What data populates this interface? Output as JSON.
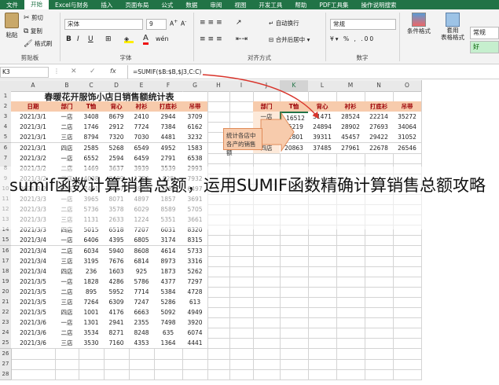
{
  "menu": [
    "文件",
    "开始",
    "Excel与财务",
    "插入",
    "页面布局",
    "公式",
    "数据",
    "审阅",
    "视图",
    "开发工具",
    "帮助",
    "PDF工具集",
    "操作说明搜索"
  ],
  "ribbon": {
    "paste": "粘贴",
    "cut": "剪切",
    "copy": "复制",
    "format_painter": "格式刷",
    "clipboard_group": "剪贴板",
    "font_name": "宋体",
    "font_size": "9",
    "font_group": "字体",
    "wrap_text": "自动换行",
    "merge_center": "合并后居中",
    "align_group": "对齐方式",
    "number_format": "常规",
    "number_group": "数字",
    "cond_format": "条件格式",
    "table_format": "套用\n表格格式",
    "style_normal": "常规",
    "style_good": "好"
  },
  "formula_bar": {
    "name_box": "K3",
    "fx": "fx",
    "formula": "=SUMIF($B:$B,$J3,C:C)"
  },
  "columns": [
    "A",
    "B",
    "C",
    "D",
    "E",
    "F",
    "G",
    "H",
    "I",
    "J",
    "K",
    "L",
    "M",
    "N",
    "O"
  ],
  "sheet": {
    "title": "春暖花开服饰小店日销售额统计表",
    "headers": [
      "日期",
      "部门",
      "T恤",
      "背心",
      "衬衫",
      "打底衫",
      "吊带"
    ],
    "rows": [
      [
        "2021/3/1",
        "一店",
        "3408",
        "8679",
        "2410",
        "2944",
        "3709"
      ],
      [
        "2021/3/1",
        "二店",
        "1746",
        "2912",
        "7724",
        "7384",
        "6162"
      ],
      [
        "2021/3/1",
        "三店",
        "8794",
        "7320",
        "7030",
        "4481",
        "3232"
      ],
      [
        "2021/3/1",
        "四店",
        "2585",
        "5268",
        "6549",
        "4952",
        "1583"
      ],
      [
        "2021/3/2",
        "一店",
        "6552",
        "2594",
        "6459",
        "2791",
        "6538"
      ],
      [
        "2021/3/2",
        "二店",
        "1469",
        "3637",
        "3939",
        "3539",
        "2993"
      ],
      [
        "2021/3/2",
        "三店",
        "4038",
        "8409",
        "1774",
        "828",
        "7932"
      ],
      [
        "2021/3/2",
        "四店",
        "7491",
        "3957",
        "3984",
        "3483",
        "6497"
      ],
      [
        "2021/3/3",
        "一店",
        "3965",
        "8071",
        "4897",
        "1857",
        "3691"
      ],
      [
        "2021/3/3",
        "二店",
        "5736",
        "3578",
        "6029",
        "8589",
        "5705"
      ],
      [
        "2021/3/3",
        "三店",
        "1131",
        "2633",
        "1224",
        "5351",
        "3661"
      ],
      [
        "2021/3/3",
        "四店",
        "5015",
        "6518",
        "7207",
        "6031",
        "8320"
      ],
      [
        "2021/3/4",
        "一店",
        "6406",
        "4395",
        "6805",
        "3174",
        "8315"
      ],
      [
        "2021/3/4",
        "二店",
        "6034",
        "5940",
        "8608",
        "4614",
        "5733"
      ],
      [
        "2021/3/4",
        "三店",
        "3195",
        "7676",
        "6814",
        "8973",
        "3316"
      ],
      [
        "2021/3/4",
        "四店",
        "236",
        "1603",
        "925",
        "1873",
        "5262"
      ],
      [
        "2021/3/5",
        "一店",
        "1828",
        "4286",
        "5786",
        "4377",
        "7297"
      ],
      [
        "2021/3/5",
        "二店",
        "895",
        "5952",
        "7714",
        "5384",
        "4728"
      ],
      [
        "2021/3/5",
        "三店",
        "7264",
        "6309",
        "7247",
        "5286",
        "613"
      ],
      [
        "2021/3/5",
        "四店",
        "1001",
        "4176",
        "6663",
        "5092",
        "4949"
      ],
      [
        "2021/3/6",
        "一店",
        "1301",
        "2941",
        "2355",
        "7498",
        "3920"
      ],
      [
        "2021/3/6",
        "二店",
        "3534",
        "8271",
        "8248",
        "635",
        "6074"
      ],
      [
        "2021/3/6",
        "三店",
        "3530",
        "7160",
        "4353",
        "1364",
        "4441"
      ]
    ],
    "note": "统计各店中各产的销售额",
    "summary_headers": [
      "部门",
      "T恤",
      "背心",
      "衬衫",
      "打底衫",
      "吊带"
    ],
    "summary_rows": [
      [
        "一店",
        "16512",
        "31471",
        "28524",
        "22214",
        "35272"
      ],
      [
        "二店",
        "15219",
        "24894",
        "28902",
        "27693",
        "34064"
      ],
      [
        "三店",
        "32801",
        "39311",
        "45457",
        "29422",
        "31052"
      ],
      [
        "四店",
        "20863",
        "37485",
        "27961",
        "22678",
        "26546"
      ]
    ]
  },
  "caption": "sumif函数计算销售总额，运用SUMIF函数精确计算销售总额攻略",
  "colors": {
    "accent": "#217346",
    "header_fill": "#f7cbac",
    "header_text": "#9c0006",
    "arrow": "#d9342b"
  }
}
